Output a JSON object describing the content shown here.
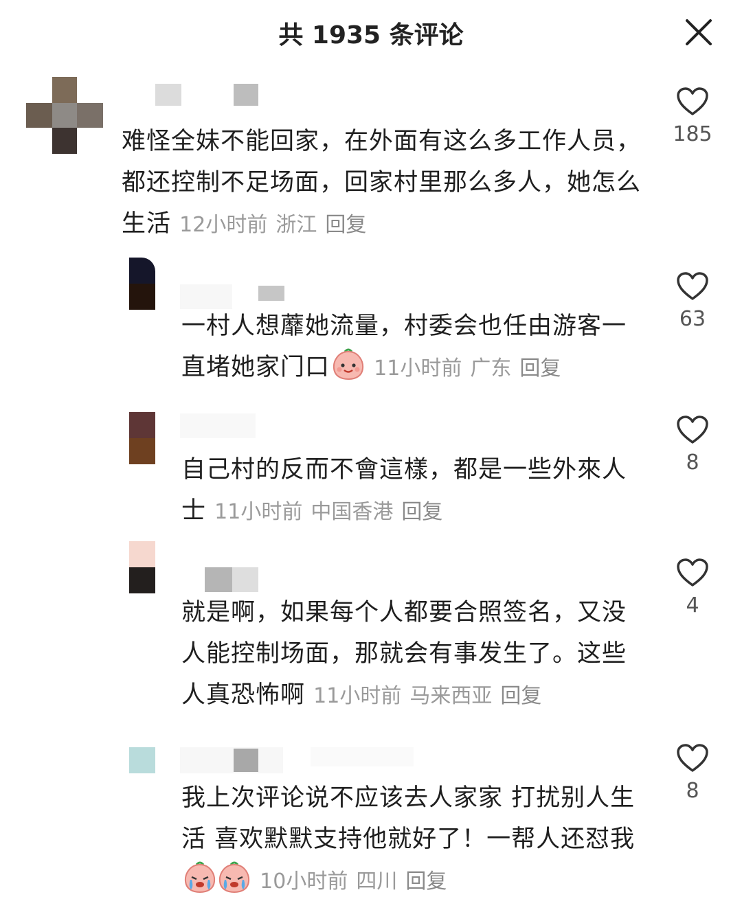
{
  "header": {
    "title": "共 1935 条评论"
  },
  "comments": [
    {
      "text": "难怪全妹不能回家，在外面有这么多工作人员，都还控制不足场面，回家村里那么多人，她怎么生活",
      "time": "12小时前",
      "location": "浙江",
      "reply": "回复",
      "likes": "185"
    },
    {
      "text": "一村人想蘼她流量，村委会也任由游客一直堵她家门口",
      "time": "11小时前",
      "location": "广东",
      "reply": "回复",
      "likes": "63",
      "emoji": "smiling-peach-emoji"
    },
    {
      "text": "自己村的反而不會這樣，都是一些外來人士",
      "time": "11小时前",
      "location": "中国香港",
      "reply": "回复",
      "likes": "8"
    },
    {
      "text": "就是啊，如果每个人都要合照签名，又没人能控制场面，那就会有事发生了。这些人真恐怖啊",
      "time": "11小时前",
      "location": "马来西亚",
      "reply": "回复",
      "likes": "4"
    },
    {
      "text": "我上次评论说不应该去人家家 打扰别人生活 喜欢默默支持他就好了！一帮人还怼我",
      "time": "10小时前",
      "location": "四川",
      "reply": "回复",
      "likes": "8",
      "emoji": "crying-peach-emoji"
    }
  ],
  "icons": {
    "close": "close-icon",
    "like": "heart-outline-icon"
  },
  "colors": {
    "text": "#1f1f1f",
    "meta": "#9a9a9a",
    "like_count": "#555555"
  }
}
